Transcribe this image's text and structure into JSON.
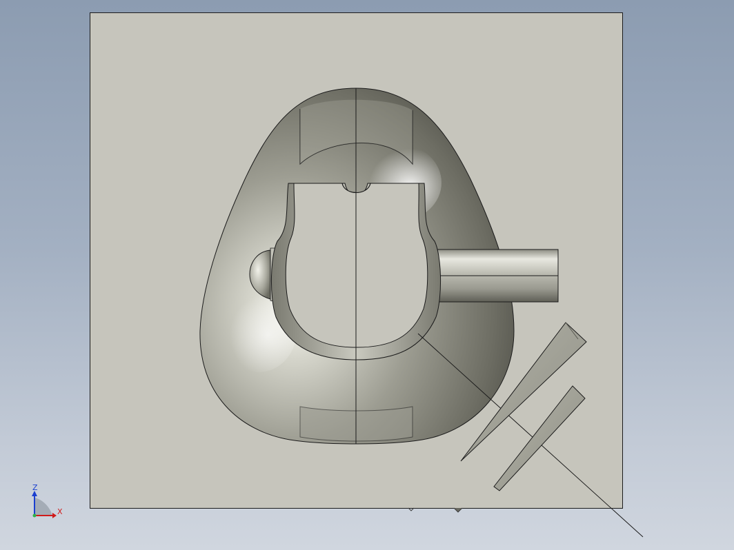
{
  "viewport": {
    "background_top": "#8c9cb1",
    "background_bottom": "#d0d6df"
  },
  "model": {
    "plate_color": "#c6c5bc",
    "body_color": "#b9b9ae",
    "line_color": "#1a1a1a"
  },
  "triad": {
    "z_label": "Z",
    "x_label": "X",
    "z_color": "#1a3fd0",
    "x_color": "#d01a1a",
    "icon": "view-orientation-triad-icon"
  }
}
